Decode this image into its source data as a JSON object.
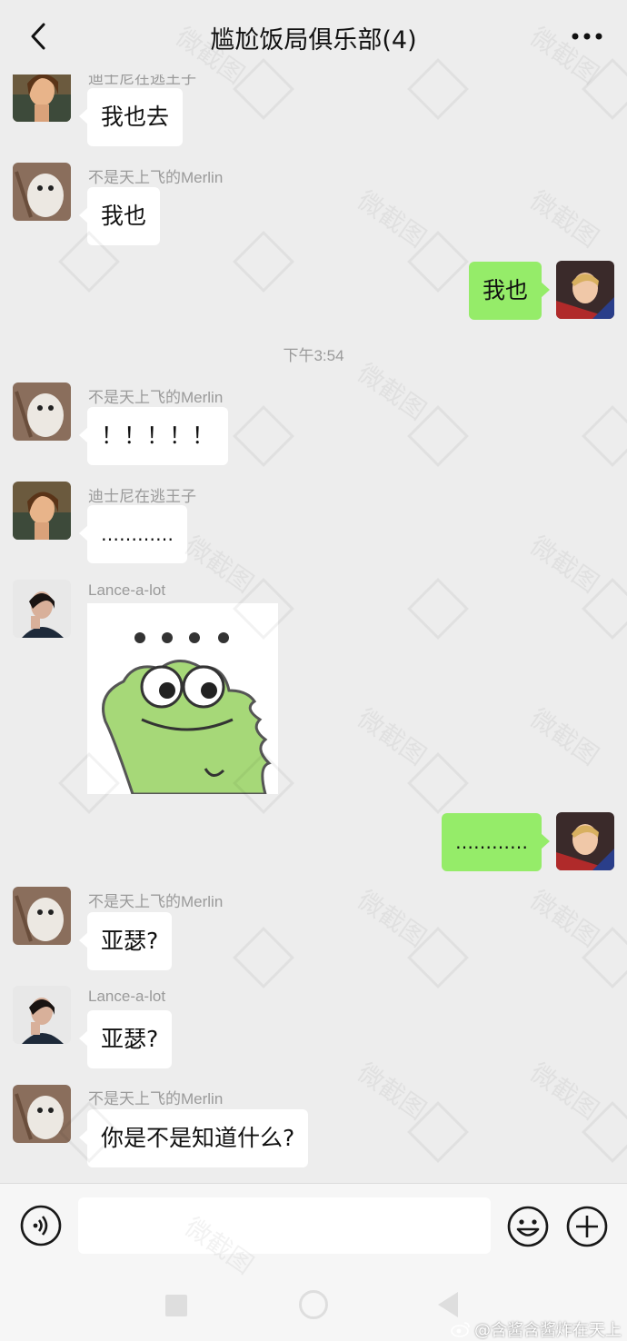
{
  "header": {
    "title": "尴尬饭局俱乐部(4)",
    "back_icon": "chevron-left-icon",
    "more_icon": "more-dots-icon"
  },
  "messages": [
    {
      "sender": "迪士尼在逃王子",
      "text": "我也去"
    },
    {
      "sender": "不是天上飞的Merlin",
      "text": "我也"
    },
    {
      "text": "我也"
    },
    {
      "time": "下午3:54"
    },
    {
      "sender": "不是天上飞的Merlin",
      "text": "！！！！！"
    },
    {
      "sender": "迪士尼在逃王子",
      "text": "…………"
    },
    {
      "sender": "Lance-a-lot",
      "sticker": "frog-sticker"
    },
    {
      "text": "…………"
    },
    {
      "sender": "不是天上飞的Merlin",
      "text": "亚瑟?"
    },
    {
      "sender": "Lance-a-lot",
      "text": "亚瑟?"
    },
    {
      "sender": "不是天上飞的Merlin",
      "text": "你是不是知道什么?"
    }
  ],
  "input": {
    "value": "",
    "voice_icon": "voice-icon",
    "emoji_icon": "emoji-icon",
    "plus_icon": "plus-icon"
  },
  "watermark": {
    "text": "微截图",
    "credit": "@含酱含酱炸在天上"
  },
  "colors": {
    "background": "#ededed",
    "outgoing_bubble": "#95ec69",
    "incoming_bubble": "#ffffff",
    "sender_name": "#9a9a9a"
  }
}
